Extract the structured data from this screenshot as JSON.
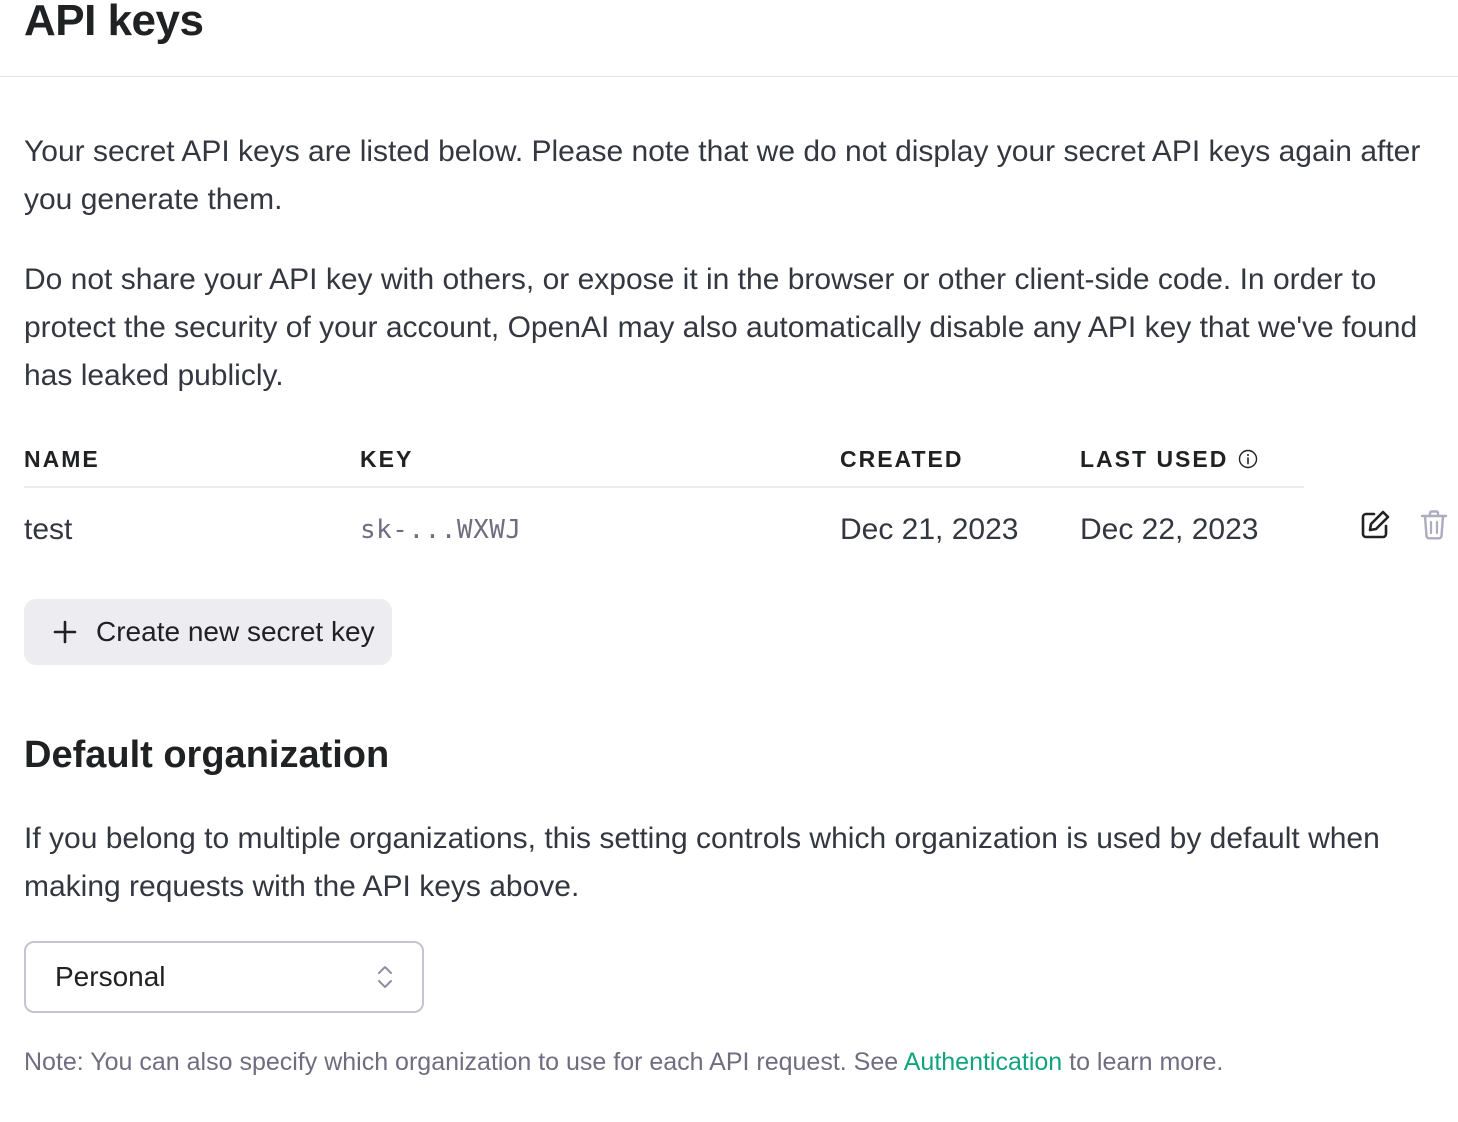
{
  "page": {
    "title": "API keys"
  },
  "intro": {
    "paragraph_1": "Your secret API keys are listed below. Please note that we do not display your secret API keys again after you generate them.",
    "paragraph_2": "Do not share your API key with others, or expose it in the browser or other client-side code. In order to protect the security of your account, OpenAI may also automatically disable any API key that we've found has leaked publicly."
  },
  "keys_table": {
    "columns": {
      "name": "NAME",
      "key": "KEY",
      "created": "CREATED",
      "last_used": "LAST USED"
    },
    "rows": [
      {
        "name": "test",
        "key": "sk-...WXWJ",
        "created": "Dec 21, 2023",
        "last_used": "Dec 22, 2023"
      }
    ],
    "icons": {
      "info": "info-icon",
      "edit": "edit-icon",
      "delete": "trash-icon"
    }
  },
  "create_button": {
    "label": "Create new secret key",
    "icon": "plus-icon"
  },
  "default_org": {
    "title": "Default organization",
    "description": "If you belong to multiple organizations, this setting controls which organization is used by default when making requests with the API keys above.",
    "selected": "Personal",
    "note_prefix": "Note: You can also specify which organization to use for each API request. See ",
    "note_link": "Authentication",
    "note_suffix": " to learn more."
  },
  "colors": {
    "text": "#202123",
    "body_text": "#353740",
    "muted": "#6e6e80",
    "link": "#10a37f",
    "button_bg": "#ececf1",
    "border": "#c5c5d2"
  }
}
